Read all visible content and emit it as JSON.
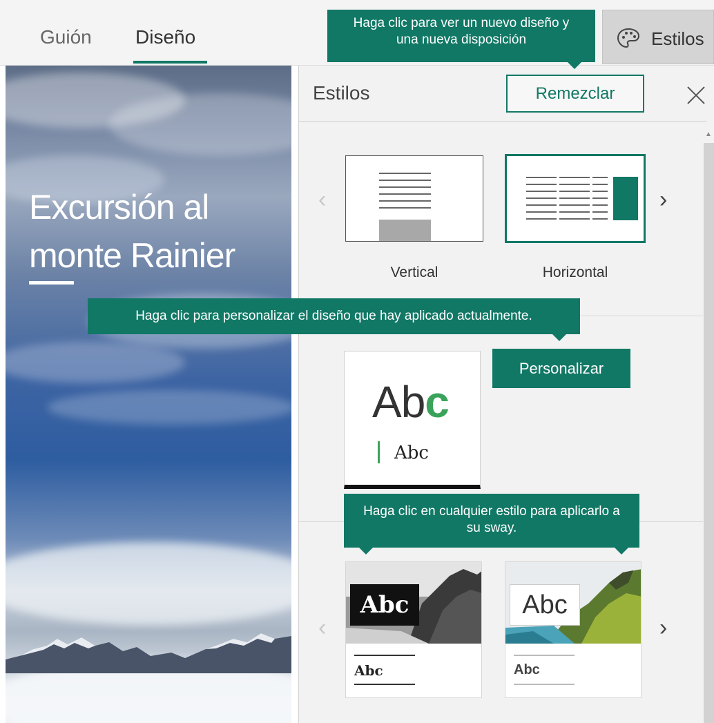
{
  "tabs": [
    {
      "label": "Guión",
      "active": false
    },
    {
      "label": "Diseño",
      "active": true
    }
  ],
  "styles_button": {
    "label": "Estilos",
    "icon": "palette-icon"
  },
  "preview": {
    "title_line1": "Excursión al",
    "title_line2": "monte Rainier"
  },
  "panel": {
    "title": "Estilos",
    "remix_label": "Remezclar",
    "close_icon": "close-icon",
    "layouts": [
      {
        "label": "Vertical",
        "selected": false
      },
      {
        "label": "Horizontal",
        "selected": true
      }
    ],
    "current_style": {
      "big_text": "Ab",
      "big_accent": "c",
      "small_text": "Abc"
    },
    "customize_label": "Personalizar",
    "styles": [
      {
        "big_text": "Abc",
        "small_text": "Abc"
      },
      {
        "big_text": "Abc",
        "small_text": "Abc"
      }
    ]
  },
  "tooltips": {
    "remix": "Haga clic para ver un nuevo diseño y una nueva disposición",
    "customize": "Haga clic para personalizar el diseño que hay aplicado actualmente.",
    "styles": "Haga clic en cualquier estilo para aplicarlo a su sway."
  },
  "colors": {
    "accent": "#117865",
    "accent_green": "#3aa35b"
  }
}
